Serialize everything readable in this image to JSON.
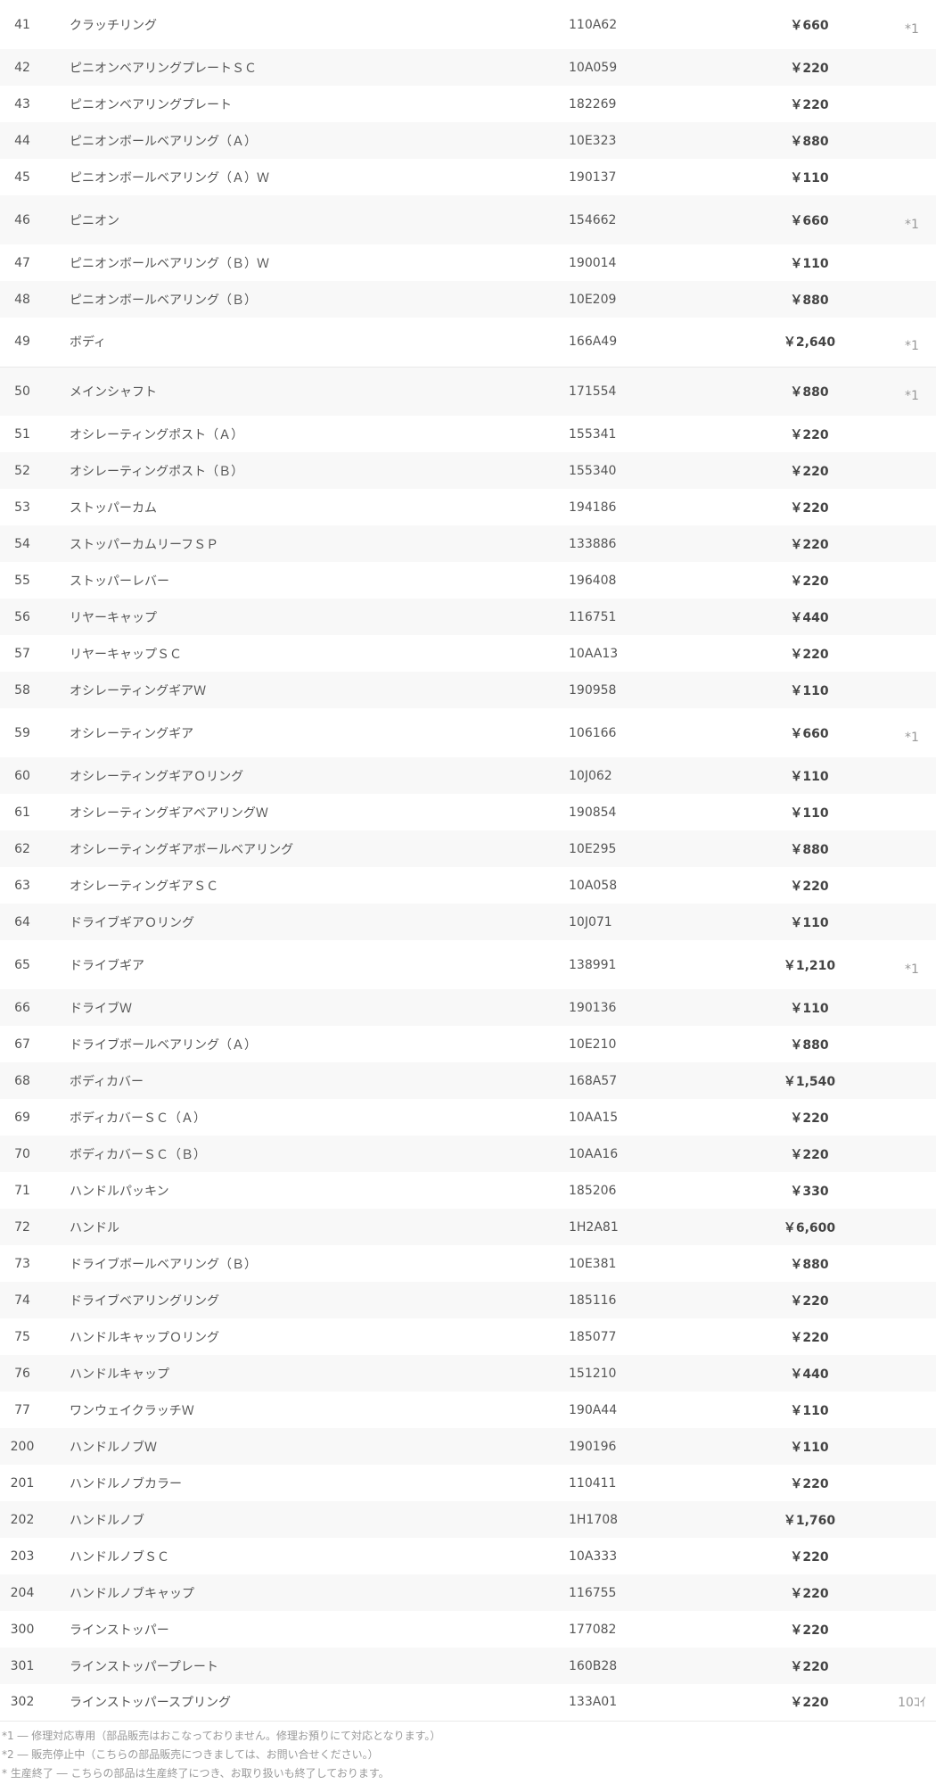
{
  "rows": [
    {
      "no": "41",
      "name": "クラッチリング",
      "code": "110A62",
      "price": "￥660",
      "note": "*1"
    },
    {
      "no": "42",
      "name": "ピニオンベアリングプレートＳＣ",
      "code": "10A059",
      "price": "￥220",
      "note": ""
    },
    {
      "no": "43",
      "name": "ピニオンベアリングプレート",
      "code": "182269",
      "price": "￥220",
      "note": ""
    },
    {
      "no": "44",
      "name": "ピニオンボールベアリング（Ａ）",
      "code": "10E323",
      "price": "￥880",
      "note": ""
    },
    {
      "no": "45",
      "name": "ピニオンボールベアリング（Ａ）Ｗ",
      "code": "190137",
      "price": "￥110",
      "note": ""
    },
    {
      "no": "46",
      "name": "ピニオン",
      "code": "154662",
      "price": "￥660",
      "note": "*1"
    },
    {
      "no": "47",
      "name": "ピニオンボールベアリング（Ｂ）Ｗ",
      "code": "190014",
      "price": "￥110",
      "note": ""
    },
    {
      "no": "48",
      "name": "ピニオンボールベアリング（Ｂ）",
      "code": "10E209",
      "price": "￥880",
      "note": ""
    },
    {
      "no": "49",
      "name": "ボディ",
      "code": "166A49",
      "price": "￥2,640",
      "note": "*1"
    },
    {
      "no": "50",
      "name": "メインシャフト",
      "code": "171554",
      "price": "￥880",
      "note": "*1"
    },
    {
      "no": "51",
      "name": "オシレーティングポスト（Ａ）",
      "code": "155341",
      "price": "￥220",
      "note": ""
    },
    {
      "no": "52",
      "name": "オシレーティングポスト（Ｂ）",
      "code": "155340",
      "price": "￥220",
      "note": ""
    },
    {
      "no": "53",
      "name": "ストッパーカム",
      "code": "194186",
      "price": "￥220",
      "note": ""
    },
    {
      "no": "54",
      "name": "ストッパーカムリーフＳＰ",
      "code": "133886",
      "price": "￥220",
      "note": ""
    },
    {
      "no": "55",
      "name": "ストッパーレバー",
      "code": "196408",
      "price": "￥220",
      "note": ""
    },
    {
      "no": "56",
      "name": "リヤーキャップ",
      "code": "116751",
      "price": "￥440",
      "note": ""
    },
    {
      "no": "57",
      "name": "リヤーキャップＳＣ",
      "code": "10AA13",
      "price": "￥220",
      "note": ""
    },
    {
      "no": "58",
      "name": "オシレーティングギアＷ",
      "code": "190958",
      "price": "￥110",
      "note": ""
    },
    {
      "no": "59",
      "name": "オシレーティングギア",
      "code": "106166",
      "price": "￥660",
      "note": "*1"
    },
    {
      "no": "60",
      "name": "オシレーティングギアＯリング",
      "code": "10J062",
      "price": "￥110",
      "note": ""
    },
    {
      "no": "61",
      "name": "オシレーティングギアベアリングＷ",
      "code": "190854",
      "price": "￥110",
      "note": ""
    },
    {
      "no": "62",
      "name": "オシレーティングギアボールベアリング",
      "code": "10E295",
      "price": "￥880",
      "note": ""
    },
    {
      "no": "63",
      "name": "オシレーティングギアＳＣ",
      "code": "10A058",
      "price": "￥220",
      "note": ""
    },
    {
      "no": "64",
      "name": "ドライブギアＯリング",
      "code": "10J071",
      "price": "￥110",
      "note": ""
    },
    {
      "no": "65",
      "name": "ドライブギア",
      "code": "138991",
      "price": "￥1,210",
      "note": "*1"
    },
    {
      "no": "66",
      "name": "ドライブＷ",
      "code": "190136",
      "price": "￥110",
      "note": ""
    },
    {
      "no": "67",
      "name": "ドライブボールベアリング（Ａ）",
      "code": "10E210",
      "price": "￥880",
      "note": ""
    },
    {
      "no": "68",
      "name": "ボディカバー",
      "code": "168A57",
      "price": "￥1,540",
      "note": ""
    },
    {
      "no": "69",
      "name": "ボディカバーＳＣ（Ａ）",
      "code": "10AA15",
      "price": "￥220",
      "note": ""
    },
    {
      "no": "70",
      "name": "ボディカバーＳＣ（Ｂ）",
      "code": "10AA16",
      "price": "￥220",
      "note": ""
    },
    {
      "no": "71",
      "name": "ハンドルパッキン",
      "code": "185206",
      "price": "￥330",
      "note": ""
    },
    {
      "no": "72",
      "name": "ハンドル",
      "code": "1H2A81",
      "price": "￥6,600",
      "note": ""
    },
    {
      "no": "73",
      "name": "ドライブボールベアリング（Ｂ）",
      "code": "10E381",
      "price": "￥880",
      "note": ""
    },
    {
      "no": "74",
      "name": "ドライブベアリングリング",
      "code": "185116",
      "price": "￥220",
      "note": ""
    },
    {
      "no": "75",
      "name": "ハンドルキャップＯリング",
      "code": "185077",
      "price": "￥220",
      "note": ""
    },
    {
      "no": "76",
      "name": "ハンドルキャップ",
      "code": "151210",
      "price": "￥440",
      "note": ""
    },
    {
      "no": "77",
      "name": "ワンウェイクラッチＷ",
      "code": "190A44",
      "price": "￥110",
      "note": ""
    },
    {
      "no": "200",
      "name": "ハンドルノブＷ",
      "code": "190196",
      "price": "￥110",
      "note": ""
    },
    {
      "no": "201",
      "name": "ハンドルノブカラー",
      "code": "110411",
      "price": "￥220",
      "note": ""
    },
    {
      "no": "202",
      "name": "ハンドルノブ",
      "code": "1H1708",
      "price": "￥1,760",
      "note": ""
    },
    {
      "no": "203",
      "name": "ハンドルノブＳＣ",
      "code": "10A333",
      "price": "￥220",
      "note": ""
    },
    {
      "no": "204",
      "name": "ハンドルノブキャップ",
      "code": "116755",
      "price": "￥220",
      "note": ""
    },
    {
      "no": "300",
      "name": "ラインストッパー",
      "code": "177082",
      "price": "￥220",
      "note": ""
    },
    {
      "no": "301",
      "name": "ラインストッパープレート",
      "code": "160B28",
      "price": "￥220",
      "note": ""
    },
    {
      "no": "302",
      "name": "ラインストッパースプリング",
      "code": "133A01",
      "price": "￥220",
      "note": "10ｺｲ"
    }
  ],
  "footnotes": [
    "*1 ― 修理対応専用（部品販売はおこなっておりません。修理お預りにて対応となります。）",
    "*2 ― 販売停止中（こちらの部品販売につきましては、お問い合せください。）",
    "* 生産終了 ― こちらの部品は生産終了につき、お取り扱いも終了しております。"
  ]
}
